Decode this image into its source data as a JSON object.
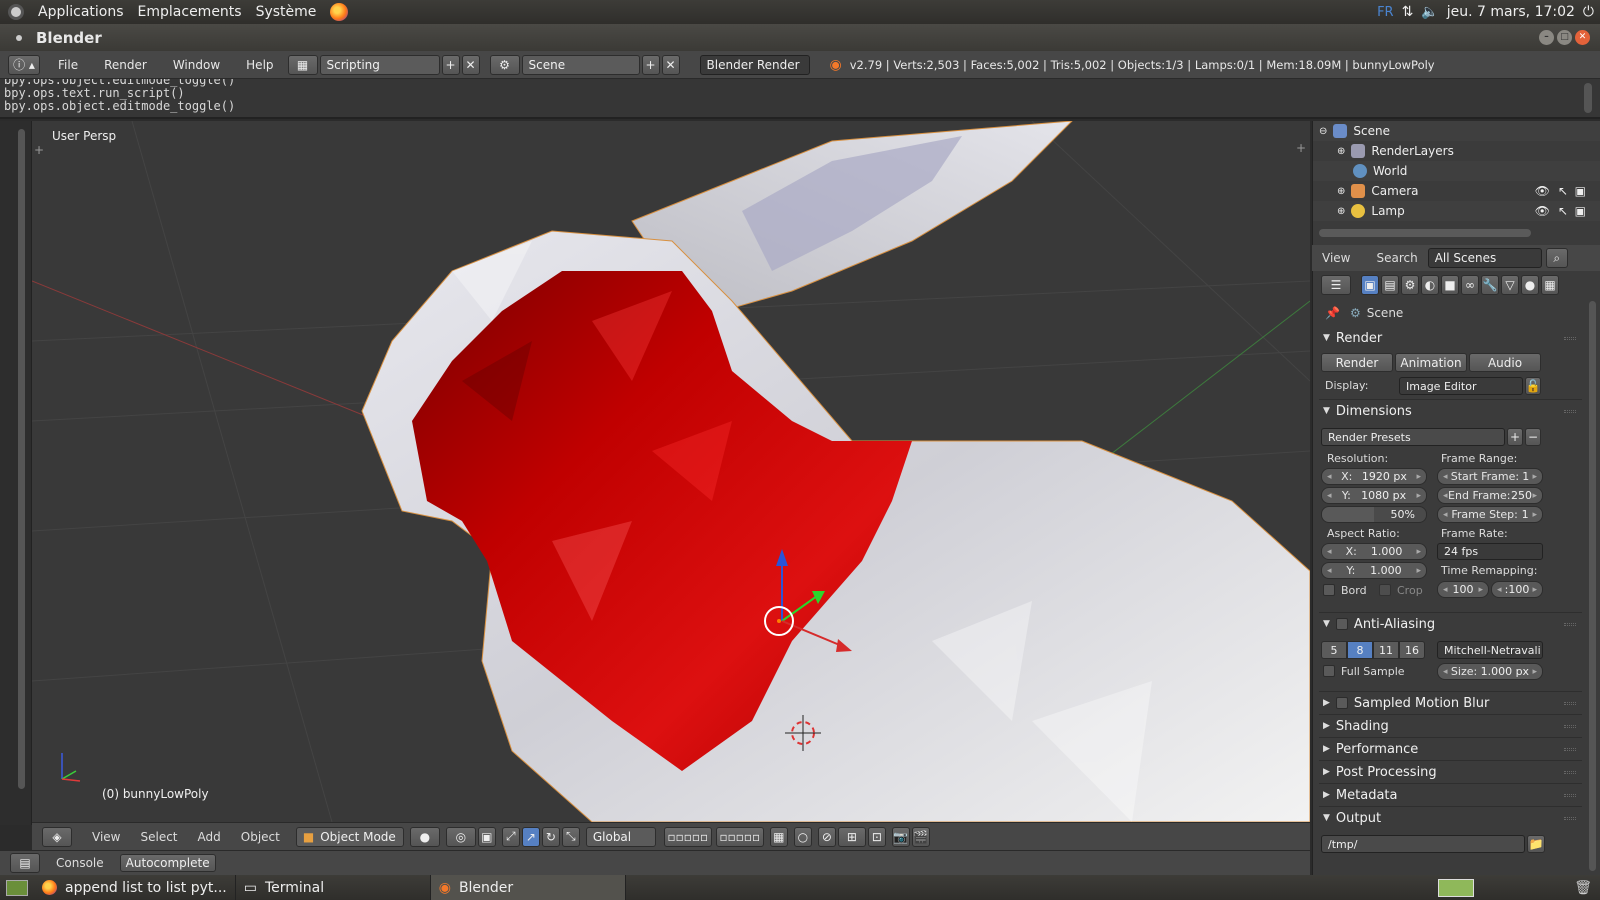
{
  "os_panel": {
    "menus": [
      "Applications",
      "Emplacements",
      "Système"
    ],
    "lang": "FR",
    "datetime": "jeu. 7 mars, 17:02"
  },
  "window": {
    "title": "Blender"
  },
  "info_header": {
    "menus": [
      "File",
      "Render",
      "Window",
      "Help"
    ],
    "screen": "Scripting",
    "scene": "Scene",
    "engine": "Blender Render",
    "stats": "v2.79 | Verts:2,503 | Faces:5,002 | Tris:5,002 | Objects:1/3 | Lamps:0/1 | Mem:18.09M | bunnyLowPoly"
  },
  "console_lines": [
    "bpy.ops.object.editmode_toggle()",
    "bpy.ops.text.run_script()",
    "bpy.ops.object.editmode_toggle()"
  ],
  "viewport": {
    "view_label": "User Persp",
    "object_label": "(0) bunnyLowPoly",
    "header": {
      "menus": [
        "View",
        "Select",
        "Add",
        "Object"
      ],
      "mode": "Object Mode",
      "orientation": "Global"
    }
  },
  "console_header": {
    "console_tab": "Console",
    "autocomplete_btn": "Autocomplete"
  },
  "outliner": {
    "items": [
      {
        "label": "Scene",
        "icon": "scene-icon"
      },
      {
        "label": "RenderLayers",
        "icon": "renderlayers-icon"
      },
      {
        "label": "World",
        "icon": "world-icon"
      },
      {
        "label": "Camera",
        "icon": "camera-icon"
      },
      {
        "label": "Lamp",
        "icon": "lamp-icon"
      }
    ],
    "header": {
      "view": "View",
      "search": "Search",
      "filter": "All Scenes"
    }
  },
  "properties": {
    "context": "Scene",
    "render_panel": {
      "title": "Render",
      "buttons": [
        "Render",
        "Animation",
        "Audio"
      ],
      "display_label": "Display:",
      "display_value": "Image Editor"
    },
    "dimensions": {
      "title": "Dimensions",
      "presets": "Render Presets",
      "resolution_label": "Resolution:",
      "res_x_label": "X:",
      "res_x": "1920 px",
      "res_y_label": "Y:",
      "res_y": "1080 px",
      "res_pct": "50%",
      "frame_range_label": "Frame Range:",
      "start_label": "Start Frame:",
      "start": "1",
      "end_label": "End Frame:",
      "end": "250",
      "step_label": "Frame Step:",
      "step": "1",
      "aspect_label": "Aspect Ratio:",
      "asp_x_label": "X:",
      "asp_x": "1.000",
      "asp_y_label": "Y:",
      "asp_y": "1.000",
      "frame_rate_label": "Frame Rate:",
      "frame_rate": "24 fps",
      "time_remap_label": "Time Remapping:",
      "remap_old": "100",
      "remap_new": ":100",
      "bord": "Bord",
      "crop": "Crop"
    },
    "anti_aliasing": {
      "title": "Anti-Aliasing",
      "samples": [
        "5",
        "8",
        "11",
        "16"
      ],
      "selected_sample": "8",
      "filter": "Mitchell-Netravali",
      "full_sample": "Full Sample",
      "size_label": "Size:",
      "size": "1.000 px"
    },
    "collapsed_panels": [
      "Sampled Motion Blur",
      "Shading",
      "Performance",
      "Post Processing",
      "Metadata"
    ],
    "output": {
      "title": "Output",
      "path": "/tmp/"
    }
  },
  "taskbar": {
    "tasks": [
      "append list to list pyt...",
      "Terminal",
      "Blender"
    ]
  },
  "colors": {
    "accent_blue": "#5680c2",
    "mesh_selected_red": "#c80000",
    "viewport_bg": "#393939"
  }
}
